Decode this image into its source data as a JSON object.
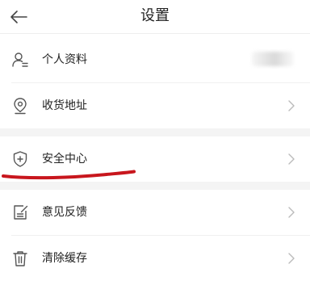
{
  "header": {
    "title": "设置",
    "back_icon": "back-arrow-icon"
  },
  "rows": [
    {
      "id": "profile",
      "label": "个人资料",
      "icon": "user-profile-icon",
      "value_visible": "blurred",
      "has_chevron": false
    },
    {
      "id": "address",
      "label": "收货地址",
      "icon": "location-pin-icon",
      "has_chevron": true
    },
    {
      "id": "security",
      "label": "安全中心",
      "icon": "shield-icon",
      "has_chevron": true,
      "annotated": true
    },
    {
      "id": "feedback",
      "label": "意见反馈",
      "icon": "feedback-edit-icon",
      "has_chevron": true
    },
    {
      "id": "cache",
      "label": "清除缓存",
      "icon": "trash-icon",
      "has_chevron": true
    }
  ],
  "colors": {
    "background": "#ffffff",
    "section_gap": "#f4f4f4",
    "text": "#222222",
    "icon": "#555555",
    "chevron": "#bbbbbb",
    "annotation": "#c8161d"
  }
}
